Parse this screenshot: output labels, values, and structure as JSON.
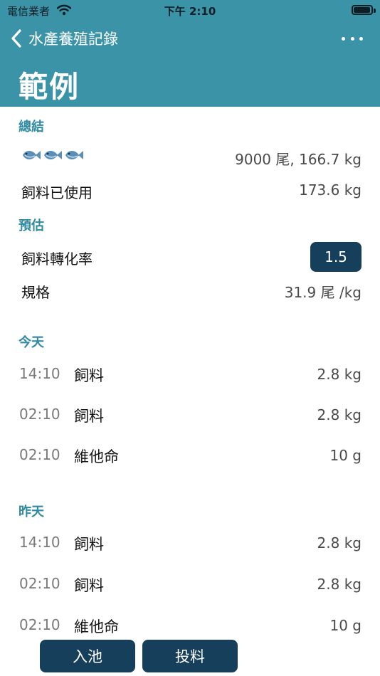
{
  "status_bar": {
    "carrier": "電信業者",
    "time": "下午 2:10"
  },
  "nav": {
    "back_label": "水產養殖記錄",
    "title": "範例"
  },
  "summary": {
    "section_label": "總結",
    "fish_count_value": "9000 尾, 166.7 kg",
    "feed_used_label": "飼料已使用",
    "feed_used_value": "173.6 kg"
  },
  "estimate": {
    "section_label": "預估",
    "fcr_label": "飼料轉化率",
    "fcr_value": "1.5",
    "size_label": "規格",
    "size_value": "31.9 尾 /kg"
  },
  "logs": [
    {
      "day": "今天",
      "entries": [
        {
          "time": "14:10",
          "type": "飼料",
          "amount": "2.8 kg"
        },
        {
          "time": "02:10",
          "type": "飼料",
          "amount": "2.8 kg"
        },
        {
          "time": "02:10",
          "type": "維他命",
          "amount": "10 g"
        }
      ]
    },
    {
      "day": "昨天",
      "entries": [
        {
          "time": "14:10",
          "type": "飼料",
          "amount": "2.8 kg"
        },
        {
          "time": "02:10",
          "type": "飼料",
          "amount": "2.8 kg"
        },
        {
          "time": "02:10",
          "type": "維他命",
          "amount": "10 g"
        }
      ]
    }
  ],
  "actions": {
    "stock_label": "入池",
    "feed_label": "投料"
  },
  "colors": {
    "header": "#3b93a8",
    "accent": "#2f8aa3",
    "button": "#163f5c"
  }
}
